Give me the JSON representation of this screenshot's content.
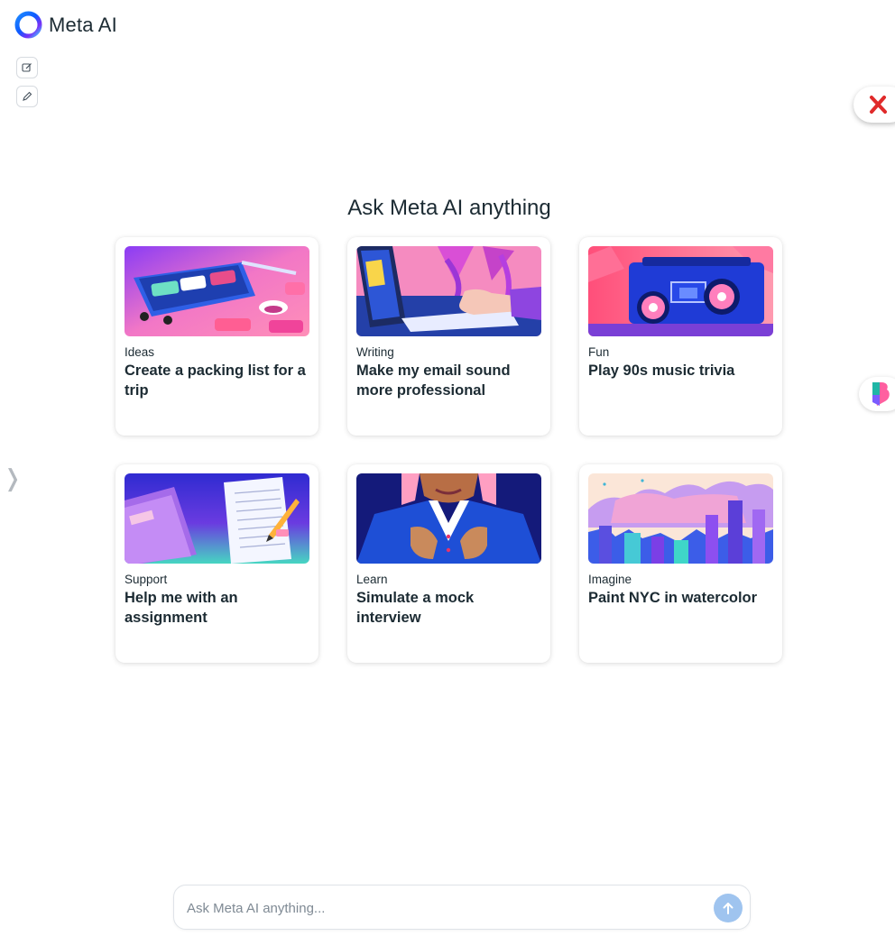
{
  "app": {
    "title": "Meta AI"
  },
  "sidebar_tools": {
    "new_chat_icon": "compose-icon",
    "pen_icon": "pencil-icon"
  },
  "main": {
    "heading": "Ask Meta AI anything"
  },
  "cards": [
    {
      "category": "Ideas",
      "title": "Create a packing list for a trip",
      "image": "suitcase-illustration"
    },
    {
      "category": "Writing",
      "title": "Make my email sound more professional",
      "image": "laptop-illustration"
    },
    {
      "category": "Fun",
      "title": "Play 90s music trivia",
      "image": "boombox-illustration"
    },
    {
      "category": "Support",
      "title": "Help me with an assignment",
      "image": "notebook-illustration"
    },
    {
      "category": "Learn",
      "title": "Simulate a mock interview",
      "image": "interview-illustration"
    },
    {
      "category": "Imagine",
      "title": "Paint NYC in watercolor",
      "image": "city-watercolor-illustration"
    }
  ],
  "composer": {
    "placeholder": "Ask Meta AI anything...",
    "send_icon": "arrow-up-icon"
  },
  "colors": {
    "accent": "#0866ff",
    "send_button": "#9fc4ef",
    "text": "#1c2b33"
  }
}
